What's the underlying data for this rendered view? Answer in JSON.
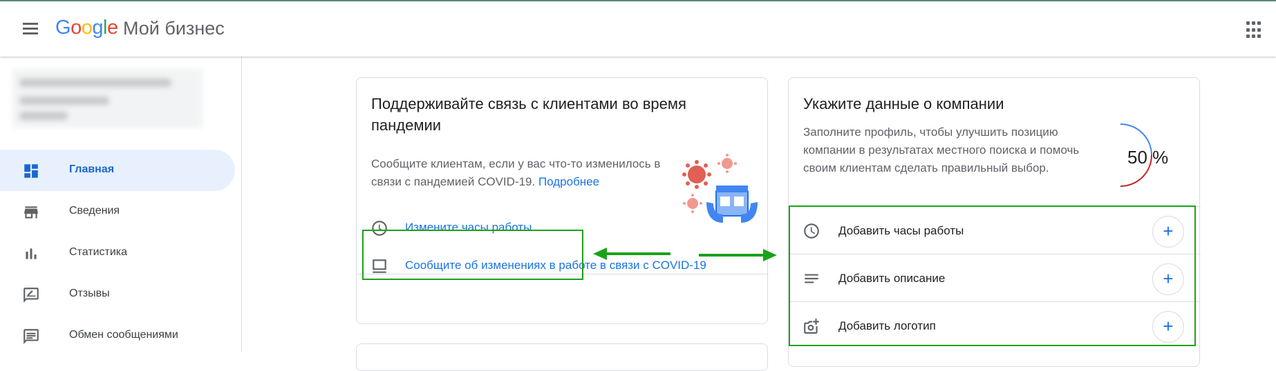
{
  "header": {
    "logo_parts": [
      "G",
      "o",
      "o",
      "g",
      "l",
      "e"
    ],
    "product": "Мой бизнес"
  },
  "sidebar": {
    "items": [
      {
        "label": "Главная",
        "icon": "dashboard-icon",
        "active": true
      },
      {
        "label": "Сведения",
        "icon": "storefront-icon"
      },
      {
        "label": "Статистика",
        "icon": "bar-chart-icon"
      },
      {
        "label": "Отзывы",
        "icon": "rate-review-icon"
      },
      {
        "label": "Обмен сообщениями",
        "icon": "message-icon"
      }
    ]
  },
  "covid_card": {
    "title": "Поддерживайте связь с клиентами во время пандемии",
    "text": "Сообщите клиентам, если у вас что-то изменилось в связи с пандемией COVID-19.",
    "more_link": "Подробнее",
    "actions": [
      {
        "label": "Измените часы работы",
        "icon": "clock-icon"
      },
      {
        "label": "Сообщите об изменениях в работе в связи с COVID-19",
        "icon": "post-icon"
      }
    ]
  },
  "profile_card": {
    "title": "Укажите данные о компании",
    "text": "Заполните профиль, чтобы улучшить позицию компании в результатах местного поиска и помочь своим клиентам сделать правильный выбор.",
    "progress_label": "50 %",
    "progress_value": 50,
    "tasks": [
      {
        "label": "Добавить часы работы",
        "icon": "clock-icon"
      },
      {
        "label": "Добавить описание",
        "icon": "notes-icon"
      },
      {
        "label": "Добавить логотип",
        "icon": "add-photo-icon"
      }
    ],
    "plus": "+"
  },
  "colors": {
    "accent": "#1a73e8",
    "highlight": "#1aa21a",
    "progress_blue": "#4285f4",
    "progress_red": "#c5221f"
  }
}
